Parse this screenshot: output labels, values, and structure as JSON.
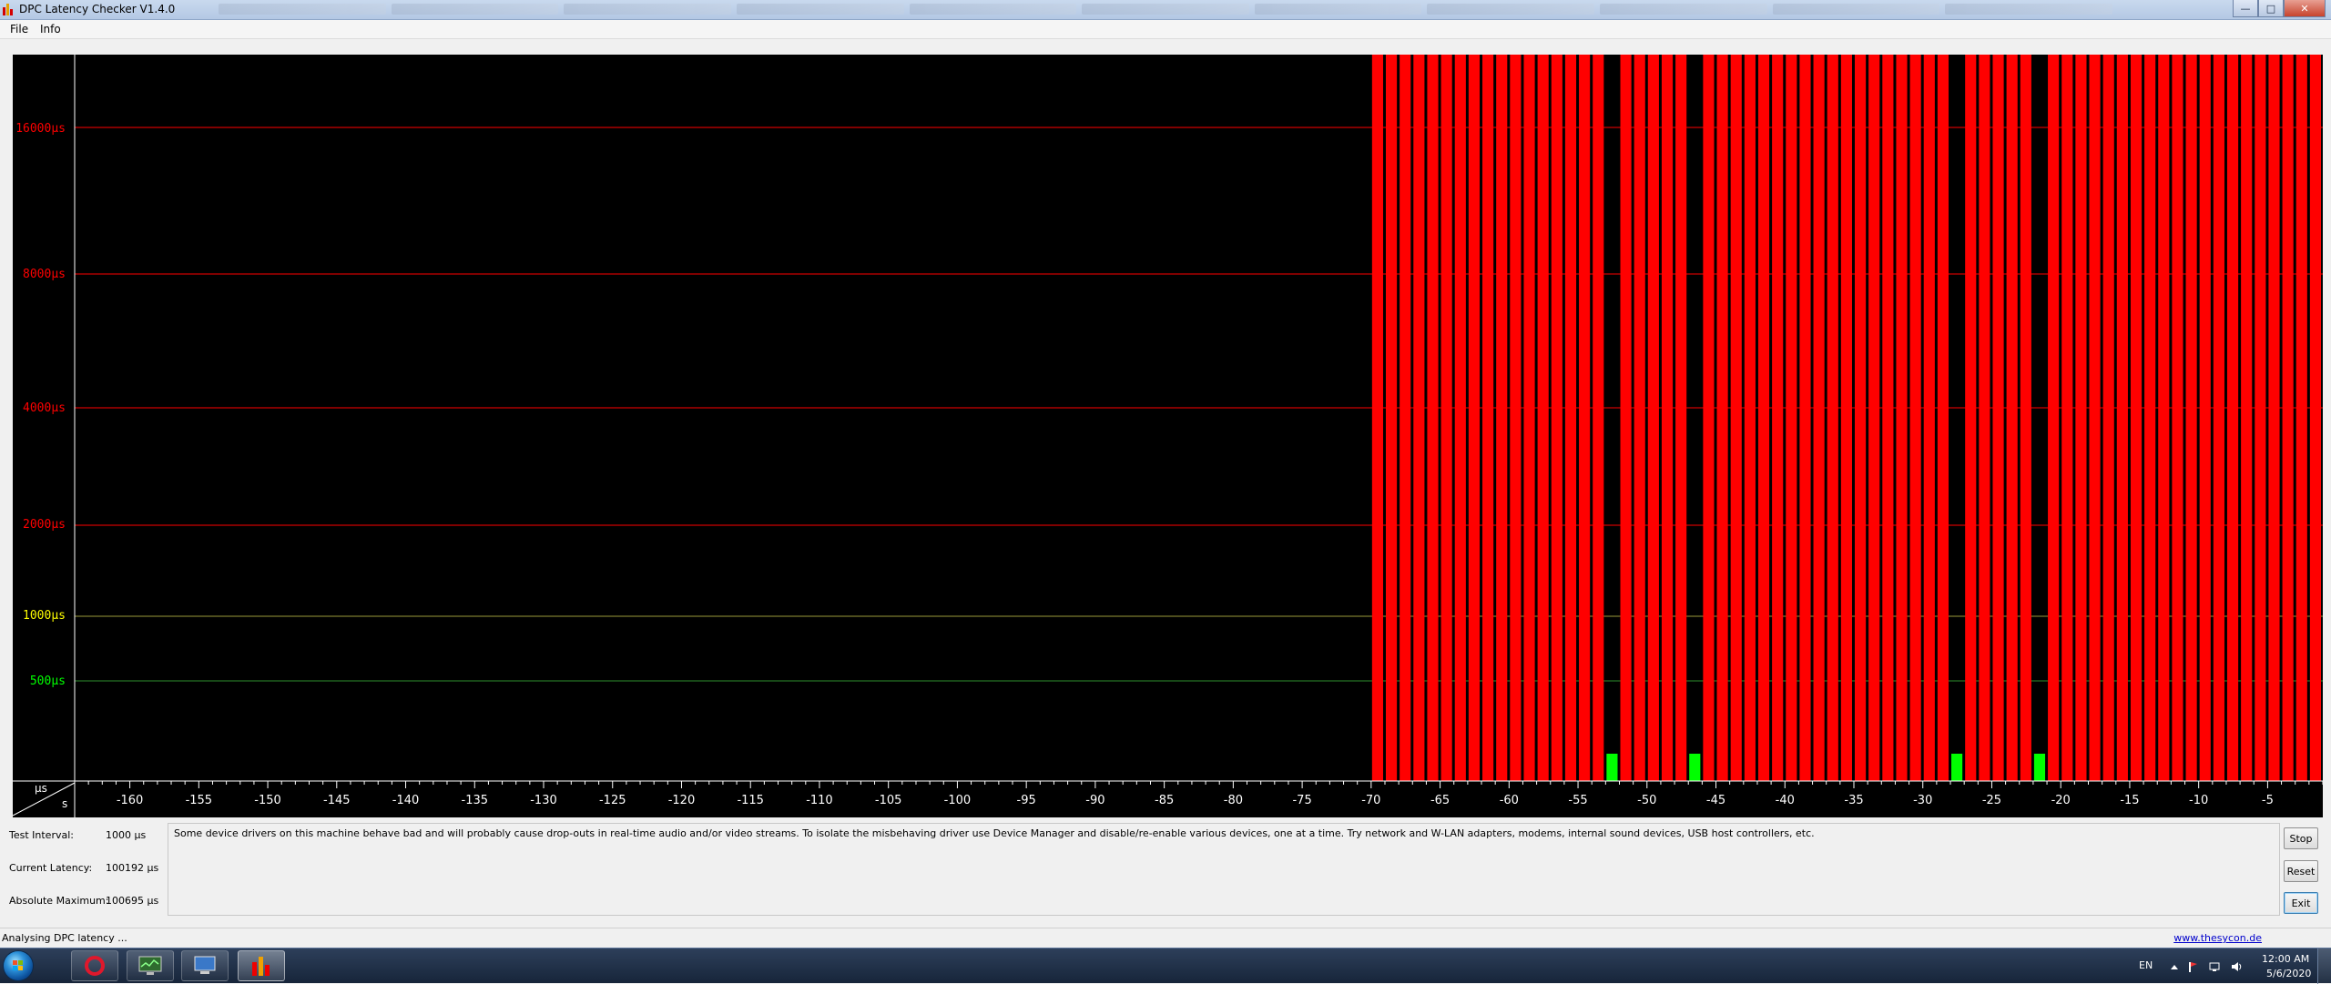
{
  "window": {
    "title": "DPC Latency Checker V1.4.0"
  },
  "menu": {
    "file": "File",
    "info": "Info"
  },
  "graph": {
    "unit_us": "µs",
    "unit_s": "s",
    "colors": {
      "background": "#000000",
      "red": "#ff0000",
      "yellow": "#ffff00",
      "green": "#00ff00"
    }
  },
  "chart_data": {
    "type": "bar",
    "y_scale": "segmented-log",
    "y_tick_labels": [
      "16000µs",
      "8000µs",
      "4000µs",
      "2000µs",
      "1000µs",
      "500µs"
    ],
    "x_tick_labels": [
      "-160",
      "-155",
      "-150",
      "-145",
      "-140",
      "-135",
      "-130",
      "-125",
      "-120",
      "-115",
      "-110",
      "-105",
      "-100",
      "-95",
      "-90",
      "-85",
      "-80",
      "-75",
      "-70",
      "-65",
      "-60",
      "-55",
      "-50",
      "-45",
      "-40",
      "-35",
      "-30",
      "-25",
      "-20",
      "-15",
      "-10",
      "-5"
    ],
    "x_range": [
      -164,
      -1
    ],
    "first_bar_second": -70,
    "green_bar_seconds": [
      -53,
      -47,
      -28,
      -22
    ],
    "red_bar_value_us": 100192,
    "green_bar_value_us": 150
  },
  "info": {
    "test_interval_label": "Test Interval:",
    "test_interval_value": "1000 µs",
    "current_latency_label": "Current Latency:",
    "current_latency_value": "100192 µs",
    "absolute_maximum_label": "Absolute Maximum:",
    "absolute_maximum_value": "100695 µs",
    "message": "Some device drivers on this machine behave bad and will probably cause drop-outs in real-time audio and/or video streams. To isolate the misbehaving driver use Device Manager and disable/re-enable various devices, one at a time. Try network and W-LAN adapters, modems, internal sound devices, USB host controllers, etc."
  },
  "buttons": {
    "stop": "Stop",
    "reset": "Reset",
    "exit": "Exit"
  },
  "status": {
    "text": "Analysing DPC latency ...",
    "link": "www.thesycon.de"
  },
  "taskbar": {
    "language": "EN",
    "time": "12:00 AM",
    "date": "5/6/2020"
  }
}
